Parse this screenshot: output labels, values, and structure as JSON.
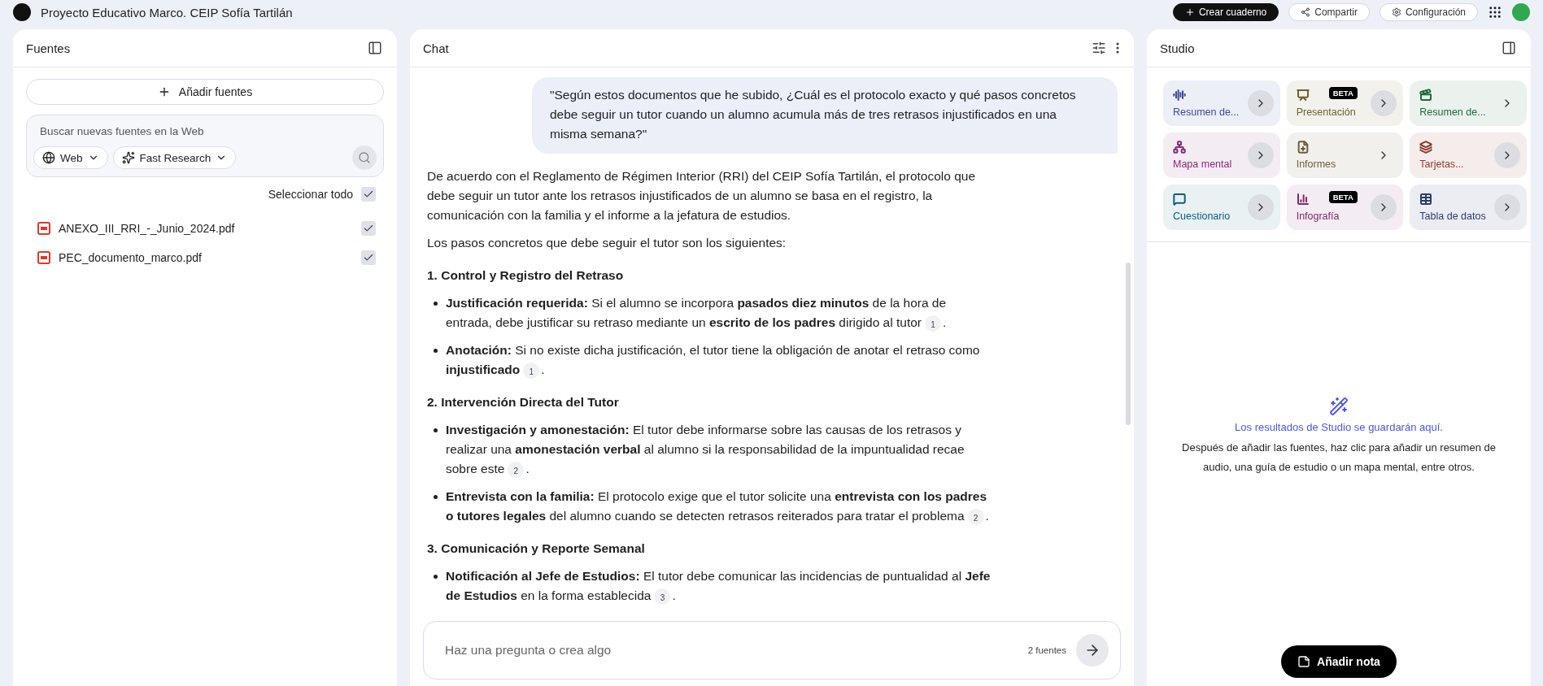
{
  "topbar": {
    "title": "Proyecto Educativo Marco. CEIP Sofía Tartilán",
    "buttons": [
      {
        "label": "Crear cuaderno",
        "kind": "primary"
      },
      {
        "label": "Compartir",
        "kind": "outline"
      },
      {
        "label": "Configuración",
        "kind": "outline"
      }
    ]
  },
  "sources": {
    "title": "Fuentes",
    "add_button": "Añadir fuentes",
    "search": {
      "placeholder": "Buscar nuevas fuentes en la Web",
      "chips": [
        {
          "label": "Web",
          "kind": "web"
        },
        {
          "label": "Fast Research",
          "kind": "research"
        }
      ]
    },
    "select_all": {
      "label": "Seleccionar todo",
      "checked": true
    },
    "files": [
      {
        "name": "ANEXO_III_RRI_-_Junio_2024.pdf",
        "checked": true
      },
      {
        "name": "PEC_documento_marco.pdf",
        "checked": true
      }
    ]
  },
  "chat": {
    "title": "Chat",
    "user_message": "\"Según estos documentos que he subido, ¿Cuál es el protocolo exacto y qué pasos concretos debe seguir un tutor cuando un alumno acumula más de tres retrasos injustificados en una misma semana?\"",
    "answer": [
      {
        "kind": "paragraph",
        "text": "De acuerdo con el Reglamento de Régimen Interior (RRI) del CEIP Sofía Tartilán, el protocolo que debe seguir un tutor ante los retrasos injustificados de un alumno se basa en el registro, la comunicación con la familia y el informe a la jefatura de estudios."
      },
      {
        "kind": "paragraph",
        "text": "Los pasos concretos que debe seguir el tutor son los siguientes:"
      },
      {
        "kind": "heading",
        "text": "1. Control y Registro del Retraso"
      },
      {
        "kind": "bullet",
        "text": "**Justificación requerida:** Si el alumno se incorpora **pasados diez minutos** de la hora de entrada, debe justificar su retraso mediante un **escrito de los padres** dirigido al tutor",
        "citation": "1",
        "tail": "."
      },
      {
        "kind": "bullet",
        "text": "**Anotación:** Si no existe dicha justificación, el tutor tiene la obligación de anotar el retraso como **injustificado**",
        "citation": "1",
        "tail": "."
      },
      {
        "kind": "heading",
        "text": "2. Intervención Directa del Tutor"
      },
      {
        "kind": "bullet",
        "text": "**Investigación y amonestación:** El tutor debe informarse sobre las causas de los retrasos y realizar una **amonestación verbal** al alumno si la responsabilidad de la impuntualidad recae sobre este",
        "citation": "2",
        "tail": "."
      },
      {
        "kind": "bullet",
        "text": "**Entrevista con la familia:** El protocolo exige que el tutor solicite una **entrevista con los padres o tutores legales** del alumno cuando se detecten retrasos reiterados para tratar el problema",
        "citation": "2",
        "tail": "."
      },
      {
        "kind": "heading",
        "text": "3. Comunicación y Reporte Semanal"
      },
      {
        "kind": "bullet",
        "text": "**Notificación al Jefe de Estudios:** El tutor debe comunicar las incidencias de puntualidad al **Jefe de Estudios** en la forma establecida",
        "citation": "3",
        "tail": "."
      }
    ],
    "input": {
      "placeholder": "Haz una pregunta o crea algo",
      "source_count": "2 fuentes"
    }
  },
  "studio": {
    "title": "Studio",
    "tools": [
      {
        "label": "Resumen de...",
        "color": "#3c4a9c",
        "round_button": true
      },
      {
        "label": "Presentación",
        "color": "#6f6230",
        "badge": "BETA",
        "round_button": true
      },
      {
        "label": "Resumen de...",
        "color": "#1f6b3d",
        "round_button": false
      },
      {
        "label": "Mapa mental",
        "color": "#8a2b7c",
        "round_button": true
      },
      {
        "label": "Informes",
        "color": "#6b5d36",
        "round_button": false
      },
      {
        "label": "Tarjetas...",
        "color": "#8a3b2b",
        "round_button": true
      },
      {
        "label": "Cuestionario",
        "color": "#0b5f7c",
        "round_button": true
      },
      {
        "label": "Infografía",
        "color": "#7c2a6c",
        "badge": "BETA",
        "round_button": true
      },
      {
        "label": "Tabla de datos",
        "color": "#2b3b6e",
        "round_button": true
      }
    ],
    "empty_title": "Los resultados de Studio se guardarán aquí.",
    "empty_text": "Después de añadir las fuentes, haz clic para añadir un resumen de audio, una guía de estudio o un mapa mental, entre otros.",
    "note_button": "Añadir nota"
  }
}
